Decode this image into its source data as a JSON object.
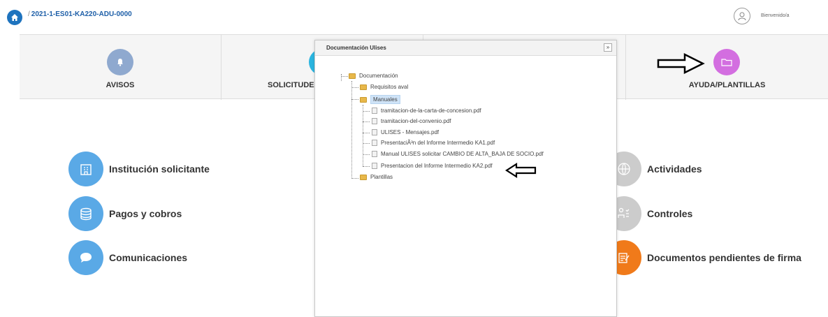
{
  "header": {
    "breadcrumb_sep": "/",
    "project_code": "2021-1-ES01-KA220-ADU-0000",
    "greeting": "Bienvenido/a"
  },
  "nav": {
    "avisos": "AVISOS",
    "solicitudes": "SOLICITUDES",
    "ayuda": "AYUDA/PLANTILLAS"
  },
  "tiles": {
    "institucion": "Institución solicitante",
    "pagos": "Pagos y cobros",
    "comunicaciones": "Comunicaciones",
    "actividades": "Actividades",
    "controles": "Controles",
    "documentos": "Documentos pendientes de firma"
  },
  "dialog": {
    "title": "Documentación Ulises",
    "close": "»",
    "tree": {
      "root": "Documentación",
      "requisitos": "Requisitos aval",
      "manuales": "Manuales",
      "files": [
        "tramitacion-de-la-carta-de-concesion.pdf",
        "tramitacion-del-convenio.pdf",
        "ULISES - Mensajes.pdf",
        "PresentaciÃ³n del Informe Intermedio KA1.pdf",
        "Manual ULISES solicitar CAMBIO DE ALTA_BAJA DE SOCIO.pdf",
        "Presentacion del Informe Intermedio KA2.pdf"
      ],
      "plantillas": "Plantillas"
    }
  },
  "colors": {
    "home": "#1e73be",
    "avisos": "#8fa9cf",
    "solicitudes": "#2bb5e0",
    "ayuda": "#d36ee0",
    "blue_tile": "#5aa9e6",
    "grey_tile": "#cccccc",
    "orange_tile": "#f07a1a"
  }
}
